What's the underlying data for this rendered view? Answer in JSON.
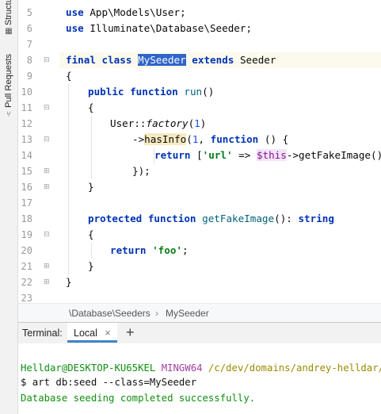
{
  "sidebar": {
    "structure_label": "Structure",
    "pull_requests_label": "Pull Requests"
  },
  "editor": {
    "line_numbers": [
      "5",
      "6",
      "7",
      "8",
      "9",
      "10",
      "11",
      "12",
      "13",
      "14",
      "15",
      "16",
      "17",
      "18",
      "19",
      "20",
      "21",
      "22",
      "23"
    ],
    "lines": {
      "l5": {
        "kw": "use",
        "rest": " App\\Models\\User;"
      },
      "l6": {
        "kw": "use",
        "rest": " Illuminate\\Database\\Seeder;"
      },
      "l8": {
        "kw1": "final",
        "kw2": "class",
        "name": "MySeeder",
        "kw3": "extends",
        "parent": "Seeder"
      },
      "l9": "{",
      "l10": {
        "kw1": "public",
        "kw2": "function",
        "fn": "run",
        "rest": "()"
      },
      "l11": "{",
      "l12": {
        "cls": "User::",
        "method": "factory",
        "open": "(",
        "num": "1",
        "close": ")"
      },
      "l13": {
        "arrow": "->",
        "method": "hasInfo",
        "open": "(",
        "num": "1",
        "comma": ", ",
        "kw": "function",
        "rest": " () {"
      },
      "l14": {
        "kw": "return",
        "open": " [",
        "str": "'url'",
        "op": " => ",
        "var": "$this",
        "call": "->getFakeImage()",
        "close": "];"
      },
      "l15": "});",
      "l16": "}",
      "l18": {
        "kw1": "protected",
        "kw2": "function",
        "fn": "getFakeImage",
        "sig": "(): ",
        "type": "string"
      },
      "l19": "{",
      "l20": {
        "kw": "return",
        "str": "'foo'",
        "end": ";"
      },
      "l21": "}",
      "l22": "}"
    }
  },
  "breadcrumbs": [
    "\\Database\\Seeders",
    "MySeeder"
  ],
  "terminal": {
    "label": "Terminal:",
    "tab": "Local",
    "close_glyph": "×",
    "add_glyph": "+",
    "prompt_user": "Helldar@DESKTOP-KU65KEL",
    "prompt_env": "MINGW64",
    "prompt_path": "/c/dev/domains/andrey-helldar/ai-",
    "command": "$ art db:seed --class=MySeeder",
    "output": "Database seeding completed successfully."
  }
}
